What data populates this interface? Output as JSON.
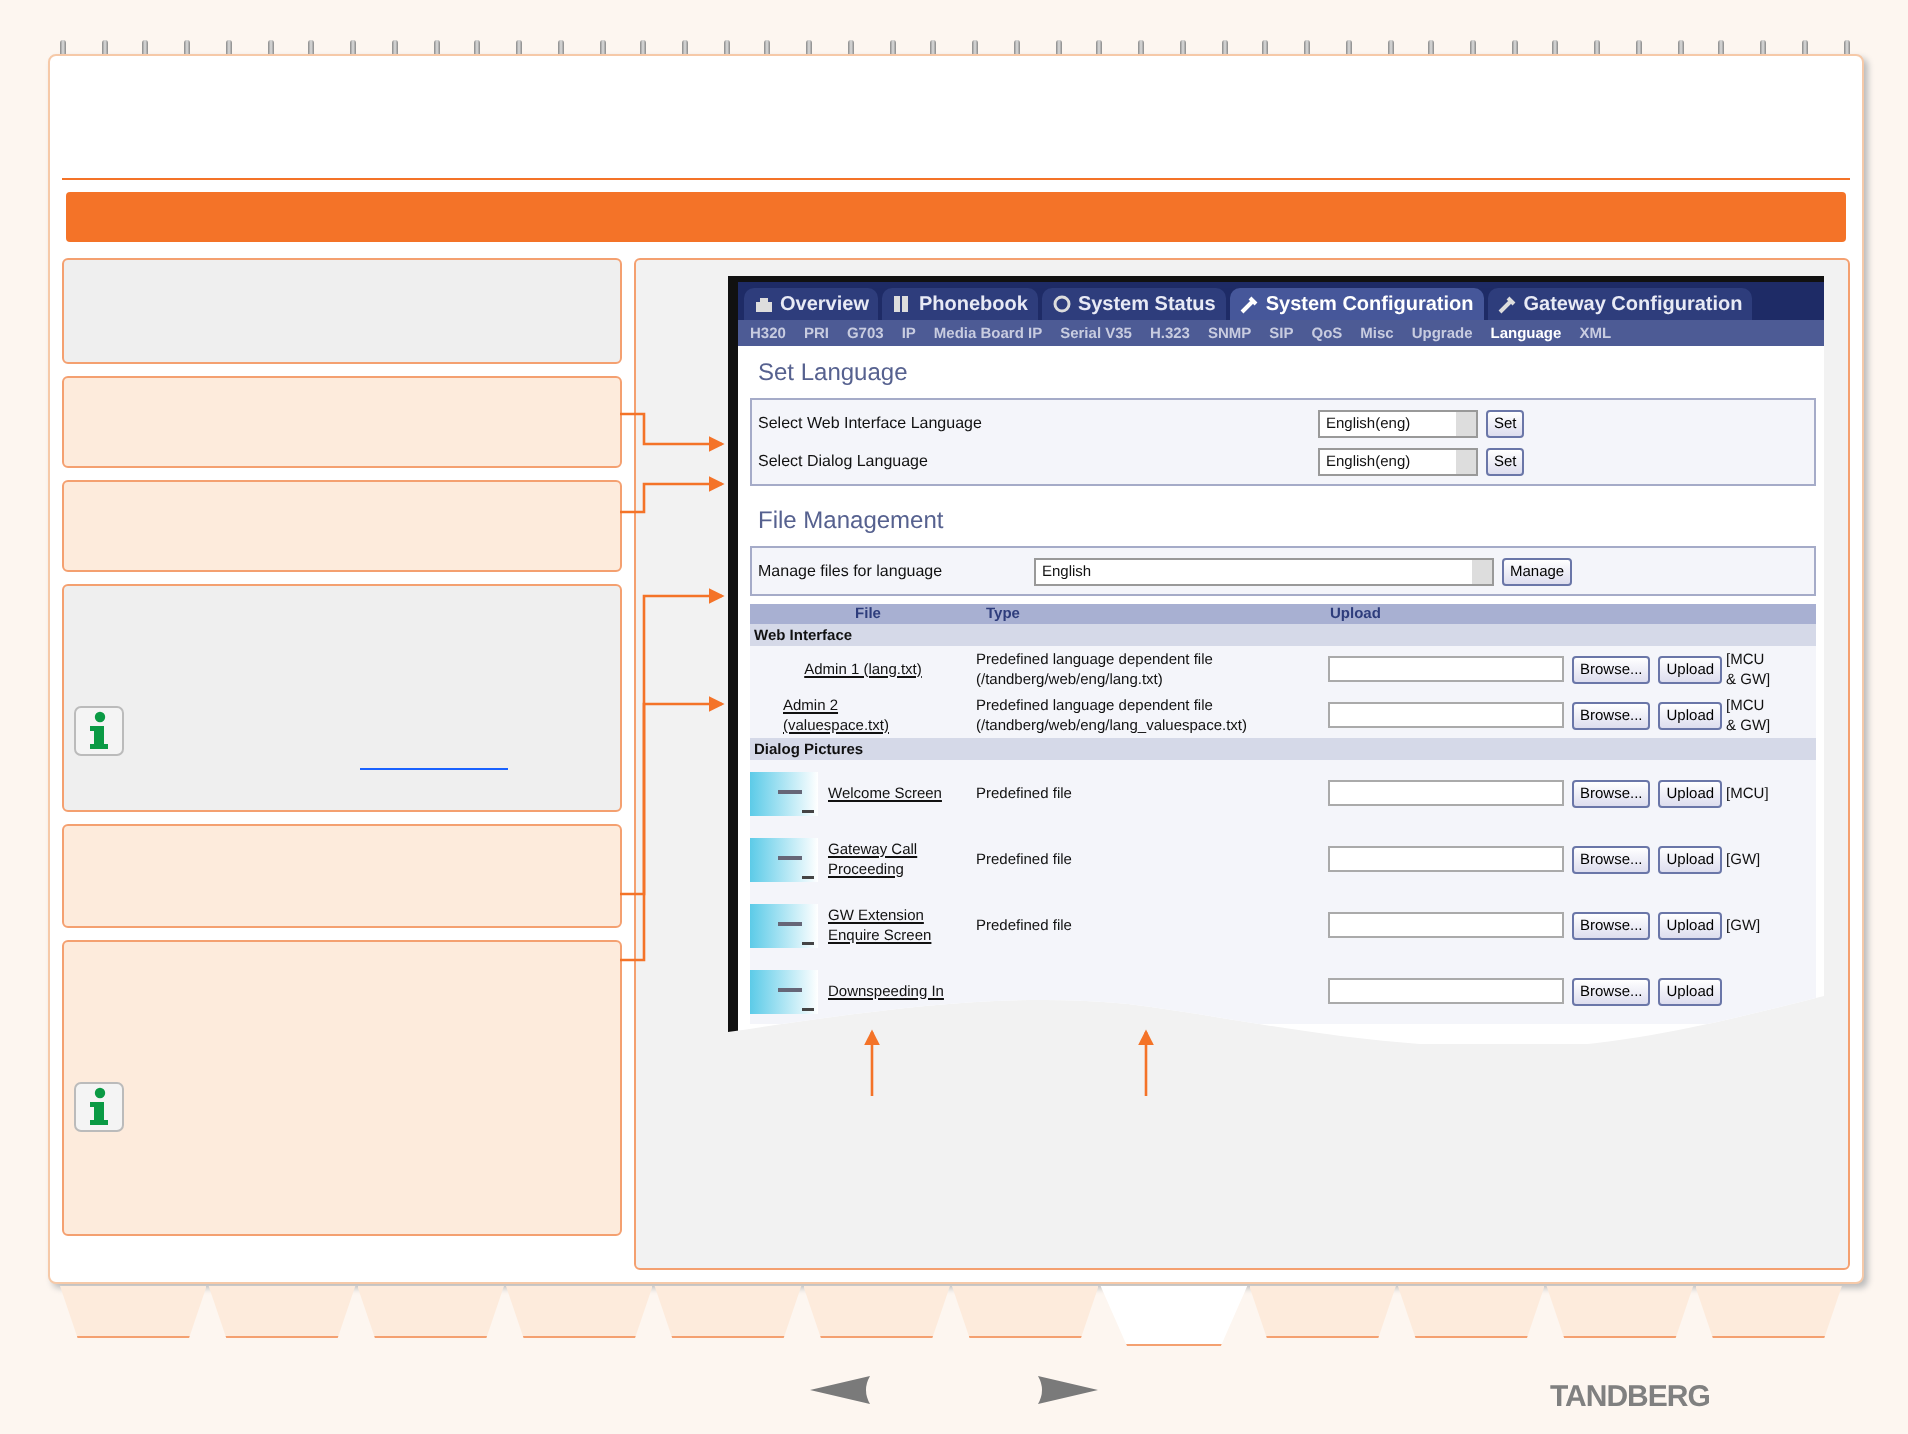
{
  "notes": [
    {
      "kind": "intro",
      "info_icon": false,
      "link": false
    },
    {
      "kind": "step",
      "info_icon": false,
      "link": false
    },
    {
      "kind": "step",
      "info_icon": false,
      "link": false
    },
    {
      "kind": "intro",
      "info_icon": true,
      "link": true
    },
    {
      "kind": "step",
      "info_icon": false,
      "link": false
    },
    {
      "kind": "step",
      "info_icon": true,
      "link": false
    }
  ],
  "screenshot": {
    "tabs": [
      {
        "label": "Overview",
        "selected": false
      },
      {
        "label": "Phonebook",
        "selected": false
      },
      {
        "label": "System Status",
        "selected": false
      },
      {
        "label": "System Configuration",
        "selected": true
      },
      {
        "label": "Gateway Configuration",
        "selected": false
      }
    ],
    "subtabs": [
      {
        "label": "H320",
        "selected": false
      },
      {
        "label": "PRI",
        "selected": false
      },
      {
        "label": "G703",
        "selected": false
      },
      {
        "label": "IP",
        "selected": false
      },
      {
        "label": "Media Board IP",
        "selected": false
      },
      {
        "label": "Serial V35",
        "selected": false
      },
      {
        "label": "H.323",
        "selected": false
      },
      {
        "label": "SNMP",
        "selected": false
      },
      {
        "label": "SIP",
        "selected": false
      },
      {
        "label": "QoS",
        "selected": false
      },
      {
        "label": "Misc",
        "selected": false
      },
      {
        "label": "Upgrade",
        "selected": false
      },
      {
        "label": "Language",
        "selected": true
      },
      {
        "label": "XML",
        "selected": false
      }
    ],
    "set_language": {
      "title": "Set Language",
      "rows": [
        {
          "label": "Select Web Interface Language",
          "value": "English(eng)",
          "button": "Set"
        },
        {
          "label": "Select Dialog Language",
          "value": "English(eng)",
          "button": "Set"
        }
      ]
    },
    "file_management": {
      "title": "File Management",
      "label": "Manage files for language",
      "value": "English",
      "button": "Manage",
      "columns": [
        "File",
        "Type",
        "Upload"
      ],
      "groups": [
        {
          "name": "Web Interface",
          "rows": [
            {
              "kind": "text",
              "file": "Admin 1 (lang.txt)",
              "type": "Predefined language dependent file (/tandberg/web/eng/lang.txt)",
              "browse": "Browse...",
              "upload": "Upload",
              "scope": "[MCU & GW]"
            },
            {
              "kind": "text",
              "file": "Admin 2 (valuespace.txt)",
              "type": "Predefined language dependent file (/tandberg/web/eng/lang_valuespace.txt)",
              "browse": "Browse...",
              "upload": "Upload",
              "scope": "[MCU & GW]"
            }
          ]
        },
        {
          "name": "Dialog Pictures",
          "rows": [
            {
              "kind": "picture",
              "file": "Welcome Screen",
              "type": "Predefined file",
              "browse": "Browse...",
              "upload": "Upload",
              "scope": "[MCU]"
            },
            {
              "kind": "picture",
              "file": "Gateway Call Proceeding",
              "type": "Predefined file",
              "browse": "Browse...",
              "upload": "Upload",
              "scope": "[GW]"
            },
            {
              "kind": "picture",
              "file": "GW Extension Enquire Screen",
              "type": "Predefined file",
              "browse": "Browse...",
              "upload": "Upload",
              "scope": "[GW]"
            },
            {
              "kind": "picture",
              "file": "Downspeeding In",
              "browse": "Browse...",
              "upload": "Upload"
            }
          ]
        }
      ]
    }
  },
  "bottom_tabs": [
    {
      "selected": false
    },
    {
      "selected": false
    },
    {
      "selected": false
    },
    {
      "selected": false
    },
    {
      "selected": false
    },
    {
      "selected": false
    },
    {
      "selected": false
    },
    {
      "selected": true
    },
    {
      "selected": false
    },
    {
      "selected": false
    },
    {
      "selected": false
    },
    {
      "selected": false
    }
  ],
  "brand": "TANDBERG"
}
